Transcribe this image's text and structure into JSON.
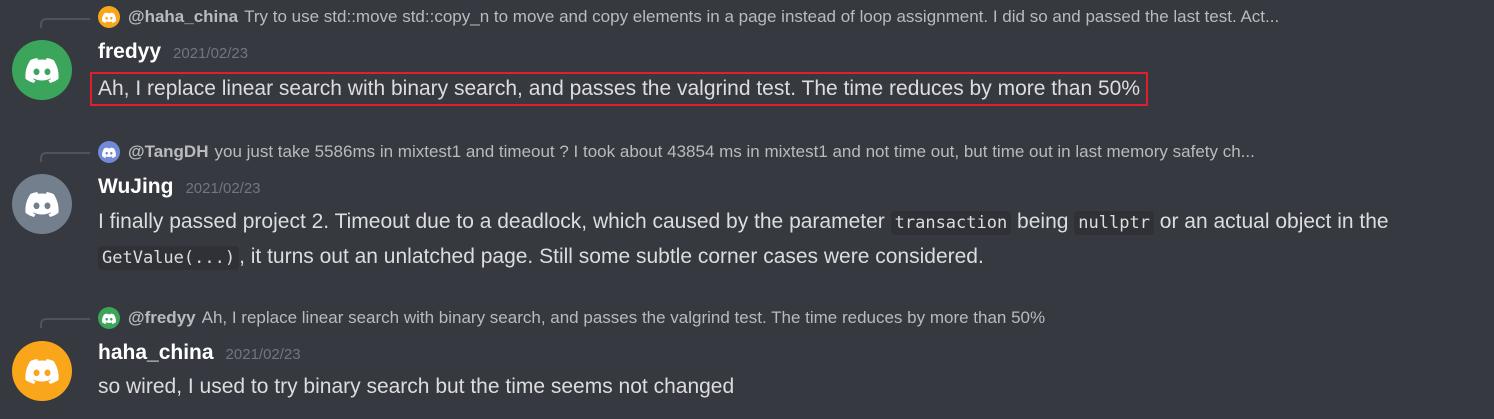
{
  "colors": {
    "background": "#36393f",
    "green_avatar": "#3ba55c",
    "gray_avatar": "#747f8d",
    "orange_avatar": "#faa61a",
    "highlight_border": "#e01e2f"
  },
  "messages": [
    {
      "reply_to": {
        "name": "@haha_china",
        "text": "Try to use std::move std::copy_n to move and copy elements in a page instead of loop assignment. I did so and passed the last test. Act..."
      },
      "username": "fredyy",
      "timestamp": "2021/02/23",
      "text": "Ah, I replace linear search with binary search, and passes the valgrind test. The time reduces by more than 50%"
    },
    {
      "reply_to": {
        "name": "@TangDH",
        "text": "you just take 5586ms in mixtest1 and timeout ? I took about 43854 ms in mixtest1 and not time out, but time out in last memory safety ch..."
      },
      "username": "WuJing",
      "timestamp": "2021/02/23",
      "text_parts": [
        "I finally passed project 2. Timeout due to a deadlock, which caused by the parameter ",
        "transaction",
        " being ",
        "nullptr",
        " or an actual object in the ",
        "GetValue(...)",
        ", it turns out an unlatched page. Still some subtle corner cases were considered."
      ]
    },
    {
      "reply_to": {
        "name": "@fredyy",
        "text": "Ah, I replace linear search with binary search, and passes the valgrind test. The time reduces by more than 50%"
      },
      "username": "haha_china",
      "timestamp": "2021/02/23",
      "text": "so wired, I used to try binary search but the time seems not changed"
    }
  ]
}
